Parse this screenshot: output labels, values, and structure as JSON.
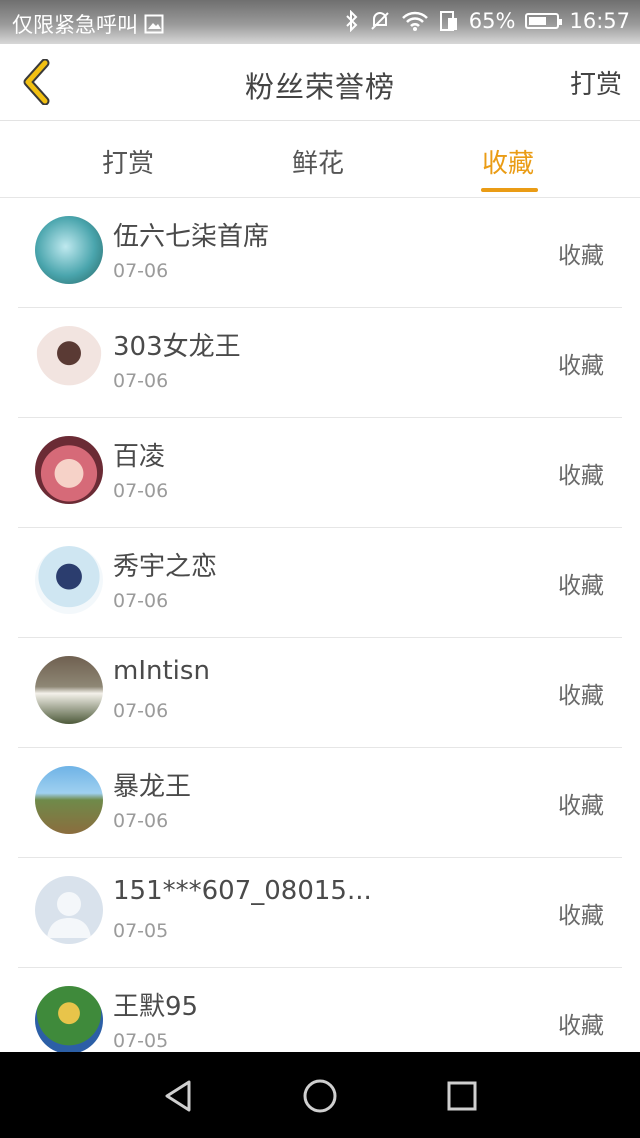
{
  "status_bar": {
    "carrier_text": "仅限紧急呼叫",
    "battery": "65%",
    "battery_level": 0.65,
    "time": "16:57"
  },
  "header": {
    "title": "粉丝荣誉榜",
    "action": "打赏"
  },
  "tabs": [
    {
      "label": "打赏",
      "active": false
    },
    {
      "label": "鲜花",
      "active": false
    },
    {
      "label": "收藏",
      "active": true
    }
  ],
  "accent_color": "#ea9c15",
  "fans": [
    {
      "name": "伍六七柒首席",
      "date": "07-06",
      "kind": "收藏"
    },
    {
      "name": "303女龙王",
      "date": "07-06",
      "kind": "收藏"
    },
    {
      "name": "百凌",
      "date": "07-06",
      "kind": "收藏"
    },
    {
      "name": "秀宇之恋",
      "date": "07-06",
      "kind": "收藏"
    },
    {
      "name": "mIntisn",
      "date": "07-06",
      "kind": "收藏"
    },
    {
      "name": "暴龙王",
      "date": "07-06",
      "kind": "收藏"
    },
    {
      "name": "151***607_08015...",
      "date": "07-05",
      "kind": "收藏"
    },
    {
      "name": "王默95",
      "date": "07-05",
      "kind": "收藏"
    }
  ]
}
